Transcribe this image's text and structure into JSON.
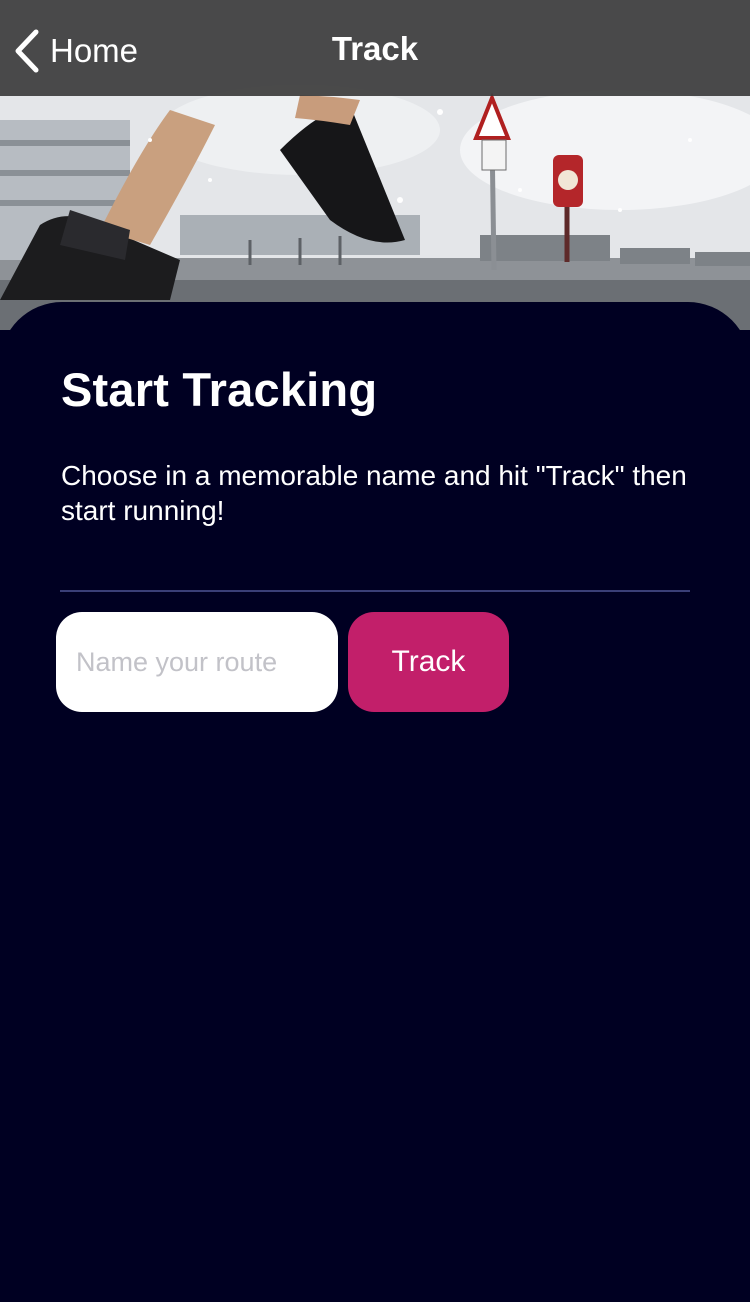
{
  "nav": {
    "back_label": "Home",
    "title": "Track"
  },
  "hero": {
    "icon": "runner-hero-image"
  },
  "card": {
    "title": "Start Tracking",
    "description": "Choose in a memorable name and hit \"Track\" then start running!"
  },
  "form": {
    "route_input_value": "",
    "route_input_placeholder": "Name your route",
    "track_button_label": "Track"
  },
  "colors": {
    "background": "#000022",
    "accent": "#c21f6a",
    "divider": "#3a3f78",
    "nav_bar": "#3c3c3c"
  }
}
